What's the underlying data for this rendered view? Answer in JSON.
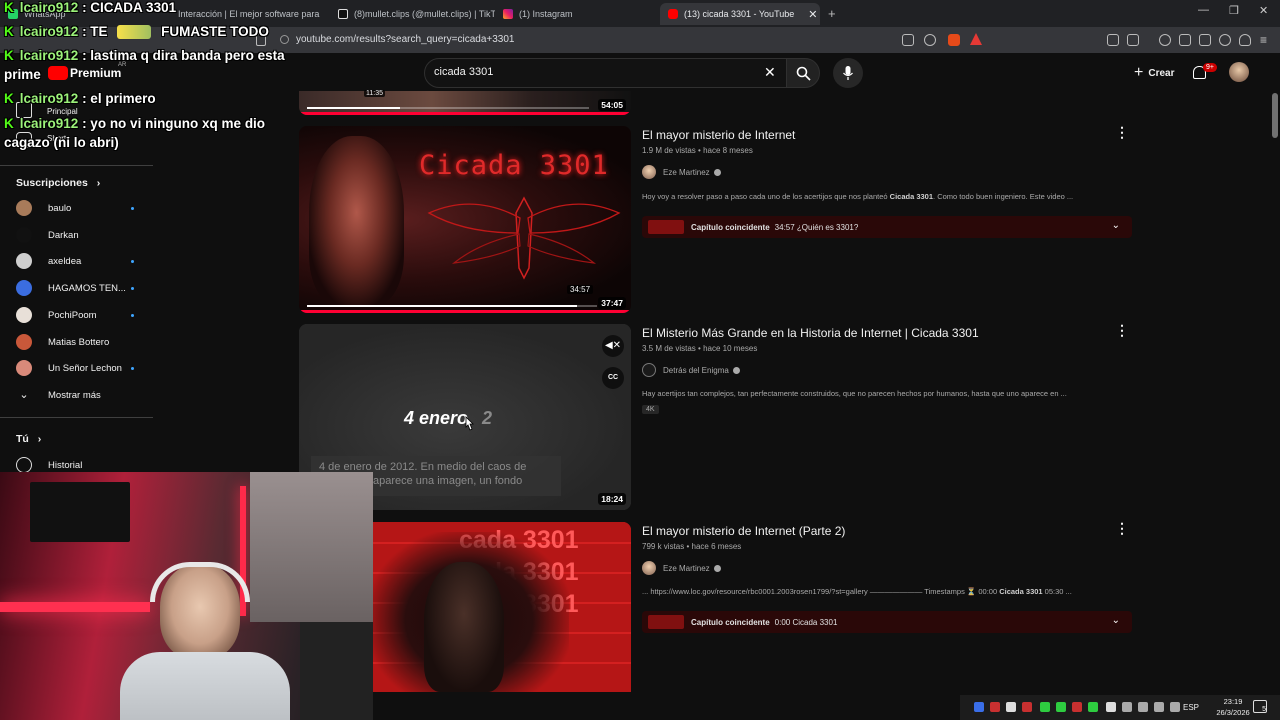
{
  "browser": {
    "tabs": [
      {
        "label": "WhatsApp",
        "active": false
      },
      {
        "label": "Interacción | El mejor software para p",
        "active": false
      },
      {
        "label": "(8)mullet.clips (@mullet.clips) | TikTok",
        "active": false
      },
      {
        "label": "(1) Instagram",
        "active": false
      },
      {
        "label": "(13) cicada 3301 - YouTube",
        "active": true
      }
    ],
    "new_tab": "+",
    "url": "youtube.com/results?search_query=cicada+3301",
    "window_controls": {
      "minimize": "—",
      "restore": "❐",
      "close": "✕"
    }
  },
  "youtube": {
    "brand": "Premium",
    "region": "AR",
    "search_value": "cicada 3301",
    "create_label": "Crear",
    "notif_count": "9+"
  },
  "sidebar": {
    "home": "Principal",
    "shorts": "Shorts",
    "subs_heading": "Suscripciones",
    "subscriptions": [
      {
        "name": "baulo",
        "dot": true,
        "color": "#a87b5a"
      },
      {
        "name": "Darkan",
        "dot": false,
        "color": "#111111"
      },
      {
        "name": "axeldea",
        "dot": true,
        "color": "#cfcfcf"
      },
      {
        "name": "HAGAMOS TEN...",
        "dot": true,
        "color": "#3b6de0"
      },
      {
        "name": "PochiPoom",
        "dot": true,
        "color": "#e8e0d8"
      },
      {
        "name": "Matias Bottero",
        "dot": false,
        "color": "#c9583a"
      },
      {
        "name": "Un Señor Lechon",
        "dot": true,
        "color": "#d98a7a"
      }
    ],
    "show_more": "Mostrar más",
    "you_heading": "Tú",
    "history": "Historial"
  },
  "results": [
    {
      "duration": "54:05",
      "hover_time": "11:35",
      "progress": 0.33
    },
    {
      "title": "El mayor misterio de Internet",
      "views": "1.9 M de vistas",
      "age": "hace 8 meses",
      "channel": "Eze Martinez",
      "desc_pre": "Hoy voy a resolver paso a paso cada uno de los acertijos que nos planteó ",
      "desc_bold": "Cicada 3301",
      "desc_post": ". Como todo buen ingeniero. Este video ...",
      "chapter_label": "Capítulo coincidente",
      "chapter_text": "34:57 ¿Quién es 3301?",
      "thumb_text": "Cicada 3301",
      "duration": "37:47",
      "hover_time": "34:57",
      "progress": 0.93
    },
    {
      "title": "El Misterio Más Grande en la Historia de Internet | Cicada 3301",
      "views": "3.5 M de vistas",
      "age": "hace 10 meses",
      "channel": "Detrás del Enigma",
      "desc": "Hay acertijos tan complejos, tan perfectamente construidos, que no parecen hechos por humanos, hasta que uno aparece en ...",
      "badge": "4K",
      "preview_big": "4 enero",
      "preview_small": "2",
      "caption_line1": "4 de enero de 2012. En medio del caos de",
      "caption_line2": "aparece una imagen, un fondo",
      "duration": "18:24",
      "cc": "CC"
    },
    {
      "title": "El mayor misterio de Internet (Parte 2)",
      "views": "799 k vistas",
      "age": "hace 6 meses",
      "channel": "Eze Martinez",
      "desc_pre": "... https://www.loc.gov/resource/rbc0001.2003rosen1799/?st=gallery ——————— Timestamps ⏳ 00:00 ",
      "desc_bold": "Cicada 3301",
      "desc_post": " 05:30 ...",
      "chapter_label": "Capítulo coincidente",
      "chapter_text": "0:00 Cicada 3301",
      "thumb_text": "cada 3301"
    }
  ],
  "chat": [
    {
      "user": "lcairo912",
      "msg": ": CICADA 3301"
    },
    {
      "user": "lcairo912",
      "msg": ": TE",
      "tail": "FUMASTE TODO"
    },
    {
      "user": "lcairo912",
      "msg": ": lastima q dira banda pero esta",
      "line2": "prime"
    },
    {
      "user": "lcairo912",
      "msg": ": el primero"
    },
    {
      "user": "lcairo912",
      "msg": ": yo no vi ninguno xq me dio",
      "line2": "cagazo (ni lo abri)"
    }
  ],
  "taskbar": {
    "lang": "ESP",
    "time": "23:19",
    "date": "26/3/2026",
    "notif": "5"
  }
}
